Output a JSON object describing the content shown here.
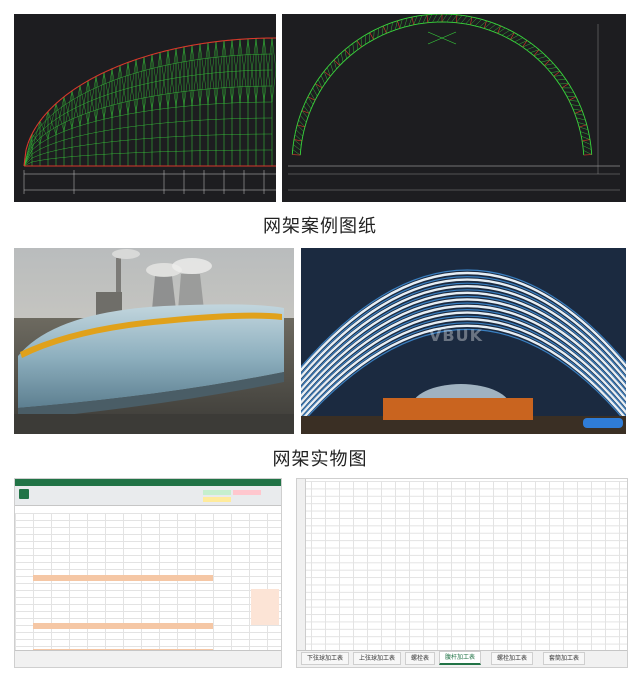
{
  "captions": {
    "drawings": "网架案例图纸",
    "photos": "网架实物图"
  },
  "spreadsheet_right": {
    "sheet_tabs": [
      "下弦球加工表",
      "上弦球加工表",
      "螺栓表",
      "腹杆加工表",
      "螺栓加工表",
      "套筒加工表"
    ],
    "active_tab": 3
  },
  "photo_watermark": "VBUK",
  "colors": {
    "cad_background": "#1d1d20",
    "cad_green": "#38d63c",
    "cad_red": "#d8392b",
    "excel_green": "#217346",
    "steel_blue": "#3a7fc0",
    "dome_yellow": "#e0a11b"
  },
  "icons": [
    "excel-icon"
  ]
}
